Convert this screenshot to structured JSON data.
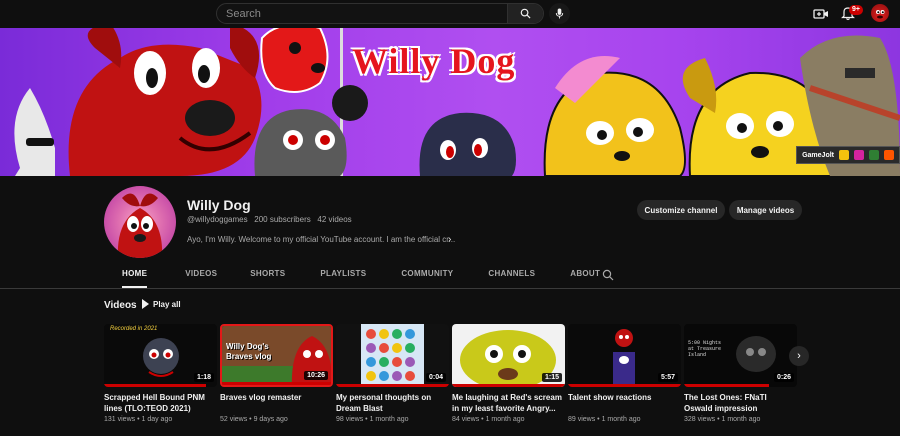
{
  "topbar": {
    "search_placeholder": "Search",
    "notification_count": "9+"
  },
  "banner": {
    "title": "Willy Dog",
    "social_label": "GameJolt"
  },
  "channel": {
    "name": "Willy Dog",
    "handle": "@willydoggames",
    "subscribers": "200 subscribers",
    "videos": "42 videos",
    "description": "Ayo, I'm Willy. Welcome to my official YouTube account. I am the official cr...",
    "customize_label": "Customize channel",
    "manage_label": "Manage videos"
  },
  "tabs": [
    "HOME",
    "VIDEOS",
    "SHORTS",
    "PLAYLISTS",
    "COMMUNITY",
    "CHANNELS",
    "ABOUT"
  ],
  "section": {
    "title": "Videos",
    "play_all": "Play all"
  },
  "videos": [
    {
      "title": "Scrapped Hell Bound PNM lines (TLO:TEOD 2021)",
      "views": "131 views",
      "age": "1 day ago",
      "duration": "1:18",
      "thumb_label": "Recorded in 2021",
      "progress": 0.9
    },
    {
      "title": "Braves vlog remaster",
      "views": "52 views",
      "age": "9 days ago",
      "duration": "10:26",
      "thumb_label": "Willy Dog's Braves vlog",
      "progress": 1.0
    },
    {
      "title": "My personal thoughts on Dream Blast",
      "views": "98 views",
      "age": "1 month ago",
      "duration": "0:04",
      "thumb_label": "",
      "progress": 1.0
    },
    {
      "title": "Me laughing at Red's scream in my least favorite Angry...",
      "views": "84 views",
      "age": "1 month ago",
      "duration": "1:15",
      "thumb_label": "",
      "progress": 1.0
    },
    {
      "title": "Talent show reactions",
      "views": "89 views",
      "age": "1 month ago",
      "duration": "5:57",
      "thumb_label": "",
      "progress": 1.0
    },
    {
      "title": "The Lost Ones: FNaTI Oswald impression",
      "views": "328 views",
      "age": "1 month ago",
      "duration": "0:26",
      "thumb_label": "5:00 Nights at Treasure Island",
      "progress": 0.75
    }
  ],
  "colors": {
    "background": "#0f0f0f",
    "accent_red": "#cc0000",
    "banner_purple": "#a13dea"
  }
}
